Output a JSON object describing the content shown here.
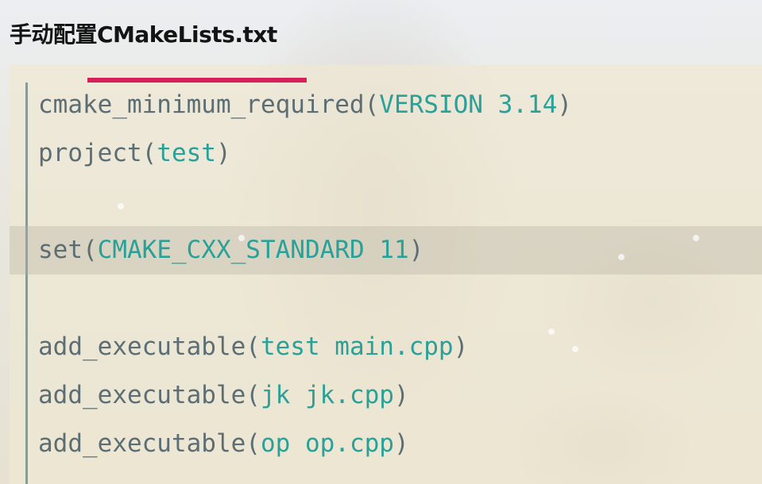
{
  "page": {
    "title": "手动配置CMakeLists.txt"
  },
  "code": {
    "lines": [
      {
        "fn": "cmake_minimum_required",
        "open": "(",
        "args": "VERSION 3.14",
        "close": ")",
        "highlight": false
      },
      {
        "fn": "project",
        "open": "(",
        "args": "test",
        "close": ")",
        "highlight": false
      },
      {
        "fn": "",
        "open": "",
        "args": "",
        "close": "",
        "highlight": false
      },
      {
        "fn": "set",
        "open": "(",
        "args": "CMAKE_CXX_STANDARD 11",
        "close": ")",
        "highlight": true
      },
      {
        "fn": "",
        "open": "",
        "args": "",
        "close": "",
        "highlight": false
      },
      {
        "fn": "add_executable",
        "open": "(",
        "args": "test main.cpp",
        "close": ")",
        "highlight": false
      },
      {
        "fn": "add_executable",
        "open": "(",
        "args": "jk jk.cpp",
        "close": ")",
        "highlight": false
      },
      {
        "fn": "add_executable",
        "open": "(",
        "args": "op op.cpp",
        "close": ")",
        "highlight": false
      }
    ]
  },
  "colors": {
    "keyword": "#5c6e74",
    "argument": "#2aa198",
    "accent_underline": "#d81e5b",
    "highlight_row": "#c9c4b2"
  }
}
